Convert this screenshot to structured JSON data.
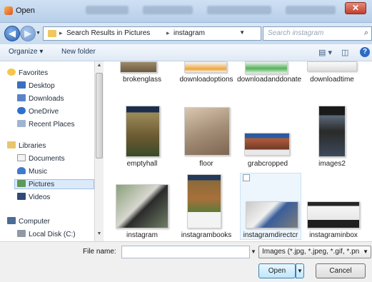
{
  "window": {
    "title": "Open"
  },
  "address": {
    "crumbs": [
      "Search Results in Pictures",
      "instagram"
    ],
    "search_placeholder": "Search instagram"
  },
  "toolbar": {
    "organize": "Organize ▾",
    "new_folder": "New folder"
  },
  "nav": {
    "favorites": "Favorites",
    "desktop": "Desktop",
    "downloads": "Downloads",
    "onedrive": "OneDrive",
    "recent": "Recent Places",
    "libraries": "Libraries",
    "documents": "Documents",
    "music": "Music",
    "pictures": "Pictures",
    "videos": "Videos",
    "computer": "Computer",
    "localdisk": "Local Disk (C:)"
  },
  "files": [
    "brokenglass",
    "downloadoptions",
    "downloadanddonate",
    "downloadtime",
    "emptyhall",
    "floor",
    "grabcropped",
    "images2",
    "instagram",
    "instagrambooks",
    "instagramdirectcr",
    "instagraminbox"
  ],
  "bottom": {
    "file_name_label": "File name:",
    "file_type": "Images (*.jpg, *.jpeg, *.gif, *.pn",
    "open": "Open",
    "cancel": "Cancel"
  }
}
